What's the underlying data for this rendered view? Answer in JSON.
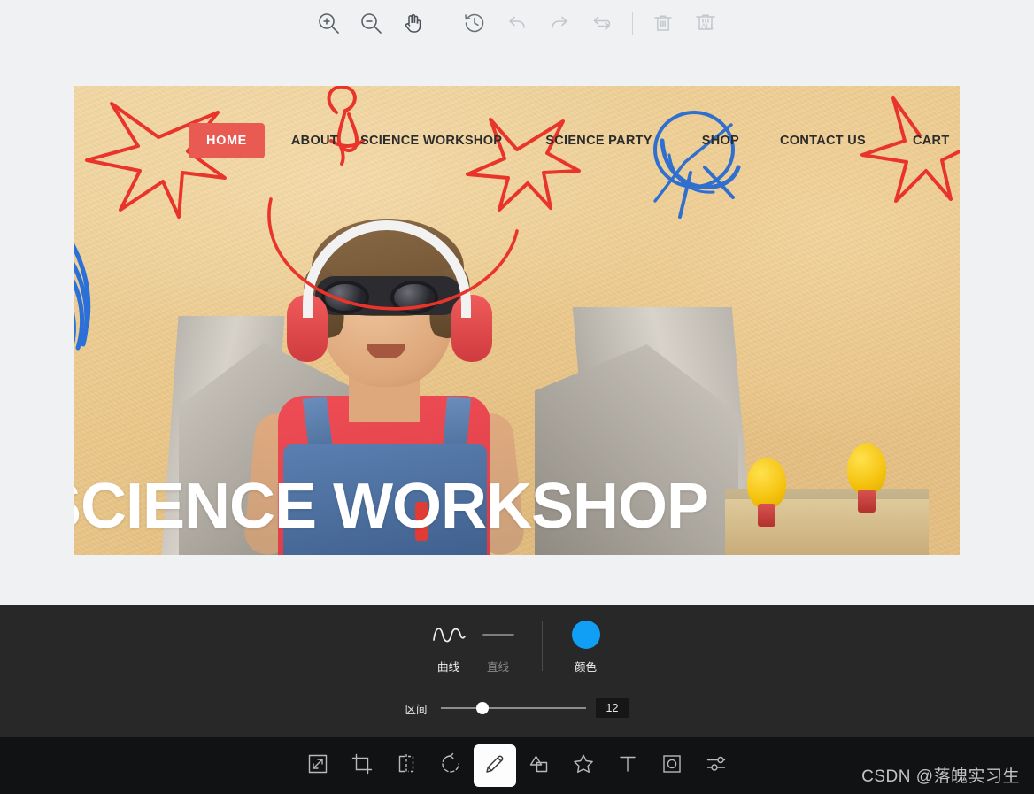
{
  "top_toolbar": {
    "buttons": [
      {
        "name": "zoom-in-icon",
        "label": "放大"
      },
      {
        "name": "zoom-out-icon",
        "label": "缩小"
      },
      {
        "name": "pan-hand-icon",
        "label": "拖动"
      },
      {
        "name": "history-icon",
        "label": "历史"
      },
      {
        "name": "undo-icon",
        "label": "撤销"
      },
      {
        "name": "redo-icon",
        "label": "重做"
      },
      {
        "name": "reset-icon",
        "label": "重置"
      },
      {
        "name": "delete-icon",
        "label": "删除"
      },
      {
        "name": "delete-all-icon",
        "label": "ALL"
      }
    ],
    "delete_all_text": "ALL"
  },
  "canvas": {
    "site": {
      "nav": {
        "home": "HOME",
        "about": "ABOUT",
        "workshop": "SCIENCE WORKSHOP",
        "party": "SCIENCE PARTY",
        "shop": "SHOP",
        "contact": "CONTACT US",
        "cart": "CART",
        "search_icon": "search-icon"
      },
      "headline": "SCIENCE WORKSHOP"
    },
    "accent_red": "#e85a52",
    "accent_blue": "#72bdec"
  },
  "options_panel": {
    "modes": [
      {
        "name": "curve",
        "label": "曲线",
        "active": true
      },
      {
        "name": "line",
        "label": "直线",
        "active": false
      }
    ],
    "color": {
      "label": "颜色",
      "value": "#109ff5"
    },
    "slider": {
      "label": "区间",
      "value": "12",
      "percent": 29
    }
  },
  "bottom_toolbar": {
    "tools": [
      {
        "name": "resize-icon",
        "label": "调整大小",
        "active": false
      },
      {
        "name": "crop-icon",
        "label": "裁剪",
        "active": false
      },
      {
        "name": "flip-icon",
        "label": "翻转",
        "active": false
      },
      {
        "name": "rotate-icon",
        "label": "旋转",
        "active": false
      },
      {
        "name": "pencil-icon",
        "label": "画笔",
        "active": true
      },
      {
        "name": "shapes-icon",
        "label": "形状",
        "active": false
      },
      {
        "name": "sticker-icon",
        "label": "贴纸",
        "active": false
      },
      {
        "name": "text-icon",
        "label": "文字",
        "active": false
      },
      {
        "name": "mask-icon",
        "label": "蒙版",
        "active": false
      },
      {
        "name": "adjust-icon",
        "label": "调整",
        "active": false
      }
    ]
  },
  "watermark": {
    "text": "CSDN @落魄实习生"
  }
}
